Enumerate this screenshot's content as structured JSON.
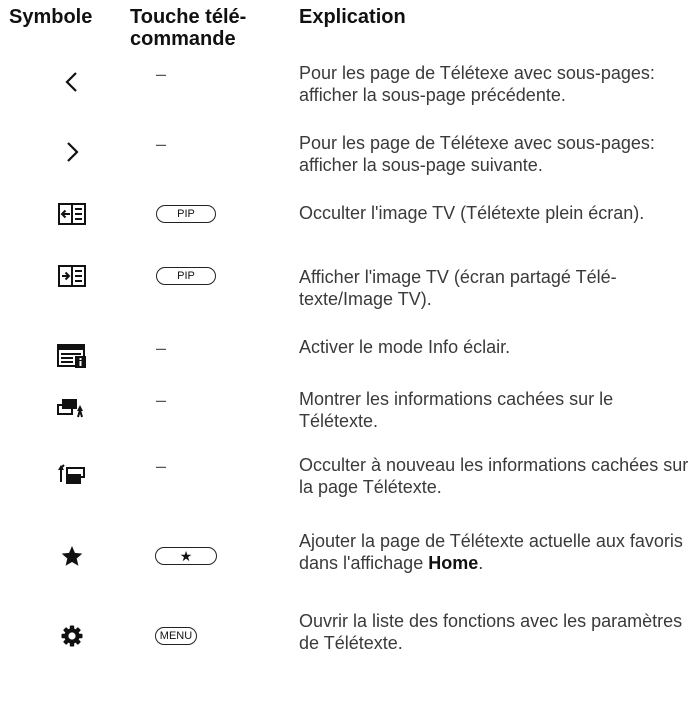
{
  "header": {
    "symbol": "Symbole",
    "key_line1": "Touche télé-",
    "key_line2": "commande",
    "explanation": "Explication"
  },
  "rows": [
    {
      "symbol_icon": "chevron-left-icon",
      "key": "–",
      "text": "Pour les page de Télétexe avec sous-pages: afficher la sous-page précédente."
    },
    {
      "symbol_icon": "chevron-right-icon",
      "key": "–",
      "text": "Pour les page de Télétexe avec sous-pages: afficher la sous-page suivante."
    },
    {
      "symbol_icon": "hide-tv-image-icon",
      "key": "PIP",
      "text": "Occulter l'image TV (Télétexte plein écran)."
    },
    {
      "symbol_icon": "show-tv-image-icon",
      "key": "PIP",
      "text": "Afficher l'image TV (écran partagé Télé-texte/Image TV)."
    },
    {
      "symbol_icon": "info-flash-icon",
      "key": "–",
      "text": "Activer le mode Info éclair."
    },
    {
      "symbol_icon": "reveal-hidden-icon",
      "key": "–",
      "text": "Montrer les informations cachées sur le Télétexte."
    },
    {
      "symbol_icon": "conceal-hidden-icon",
      "key": "–",
      "text": "Occulter à nouveau les informations cachées sur la page Télétexte."
    },
    {
      "symbol_icon": "star-icon",
      "key": "★",
      "text_before": "Ajouter la page de Télétexte actuelle aux favoris dans l'affichage ",
      "text_bold": "Home",
      "text_after": "."
    },
    {
      "symbol_icon": "gear-icon",
      "key": "MENU",
      "text": "Ouvrir la liste des fonctions avec les paramètres de Télétexte."
    }
  ]
}
